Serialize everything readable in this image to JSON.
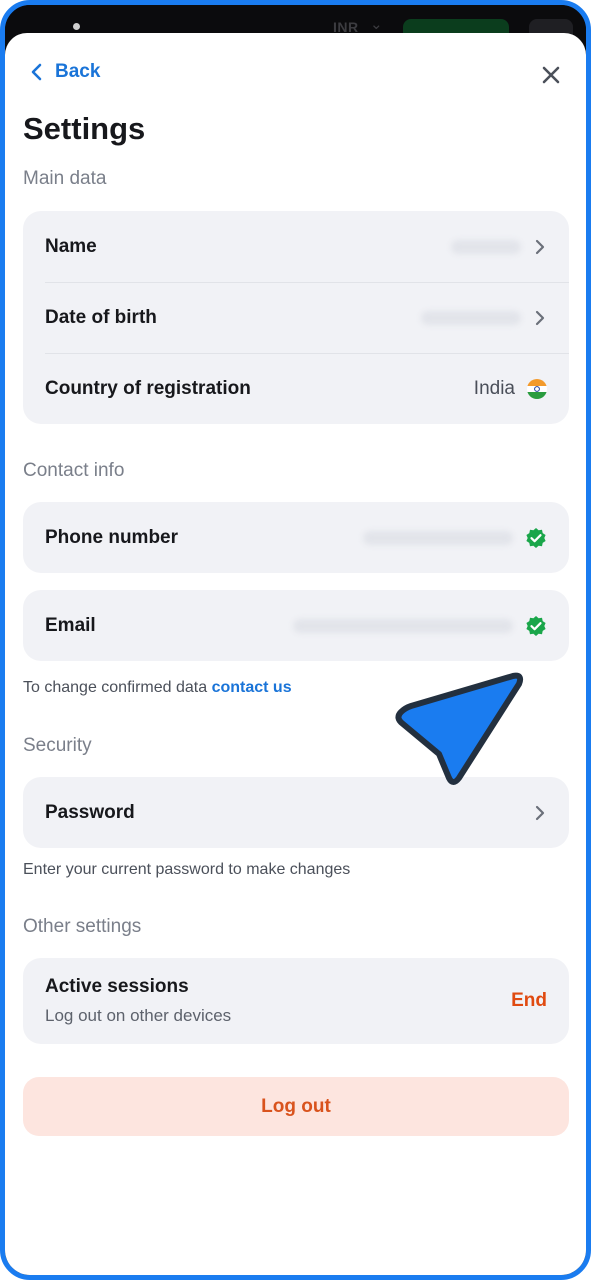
{
  "topbar": {
    "currency": "INR"
  },
  "header": {
    "back_label": "Back",
    "title": "Settings"
  },
  "main_data": {
    "section_label": "Main data",
    "rows": [
      {
        "label": "Name",
        "value": ""
      },
      {
        "label": "Date of birth",
        "value": ""
      },
      {
        "label": "Country of registration",
        "value": "India"
      }
    ]
  },
  "contact": {
    "section_label": "Contact info",
    "phone_label": "Phone number",
    "email_label": "Email",
    "note_text": "To change confirmed data",
    "note_link": "contact us"
  },
  "security": {
    "section_label": "Security",
    "password_label": "Password",
    "hint": "Enter your current password to make changes"
  },
  "other": {
    "section_label": "Other settings",
    "sessions_title": "Active sessions",
    "sessions_sub": "Log out on other devices",
    "end_label": "End"
  },
  "logout_label": "Log out",
  "colors": {
    "accent_blue": "#1a74d8",
    "verified_green": "#1aa64a",
    "danger_orange": "#e04a10",
    "logout_bg": "#fde5df",
    "card_bg": "#f1f2f6"
  },
  "icons": {
    "back": "chevron-left-icon",
    "close": "close-icon",
    "row_arrow": "chevron-right-icon",
    "verified": "verified-check-icon",
    "flag": "india-flag-icon",
    "pointer": "cursor-arrow-icon"
  }
}
